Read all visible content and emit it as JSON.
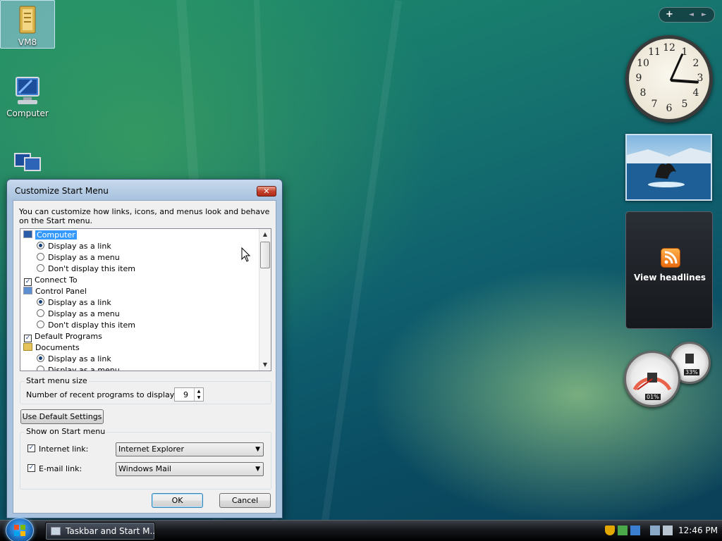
{
  "desktop": {
    "icons": [
      {
        "label": "VM8",
        "icon": "folder-icon"
      },
      {
        "label": "Computer",
        "icon": "computer-icon"
      },
      {
        "label": "",
        "icon": "network-icon"
      }
    ]
  },
  "sidebar": {
    "add_label": "+",
    "prev_label": "◄",
    "next_label": "►",
    "clock_numbers": [
      "12",
      "1",
      "2",
      "3",
      "4",
      "5",
      "6",
      "7",
      "8",
      "9",
      "10",
      "11"
    ],
    "feed_label": "View headlines",
    "cpu_value": "01%",
    "mem_value": "33%"
  },
  "dialog": {
    "title": "Customize Start Menu",
    "close_label": "✕",
    "intro": "You can customize how links, icons, and menus look and behave on the Start menu.",
    "tree": [
      {
        "type": "folder",
        "label": "Computer",
        "selected": true
      },
      {
        "type": "radio",
        "label": "Display as a link",
        "checked": true
      },
      {
        "type": "radio",
        "label": "Display as a menu",
        "checked": false
      },
      {
        "type": "radio",
        "label": "Don't display this item",
        "checked": false
      },
      {
        "type": "check",
        "label": "Connect To",
        "checked": true
      },
      {
        "type": "folder",
        "label": "Control Panel"
      },
      {
        "type": "radio",
        "label": "Display as a link",
        "checked": true
      },
      {
        "type": "radio",
        "label": "Display as a menu",
        "checked": false
      },
      {
        "type": "radio",
        "label": "Don't display this item",
        "checked": false
      },
      {
        "type": "check",
        "label": "Default Programs",
        "checked": true
      },
      {
        "type": "folder",
        "label": "Documents"
      },
      {
        "type": "radio",
        "label": "Display as a link",
        "checked": true
      },
      {
        "type": "radio",
        "label": "Display as a menu",
        "checked": false
      }
    ],
    "size_group_title": "Start menu size",
    "recent_label": "Number of recent programs to display:",
    "recent_value": "9",
    "default_button": "Use Default Settings",
    "show_group_title": "Show on Start menu",
    "internet_label": "Internet link:",
    "internet_value": "Internet Explorer",
    "email_label": "E-mail link:",
    "email_value": "Windows Mail",
    "ok_label": "OK",
    "cancel_label": "Cancel"
  },
  "taskbar": {
    "task_label": "Taskbar and Start M...",
    "time": "12:46 PM"
  }
}
